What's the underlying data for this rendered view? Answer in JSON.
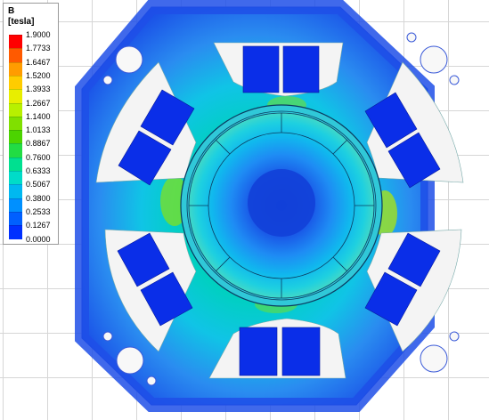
{
  "legend": {
    "quantity": "B",
    "unit": "[tesla]",
    "ticks": [
      "1.9000",
      "1.7733",
      "1.6467",
      "1.5200",
      "1.3933",
      "1.2667",
      "1.1400",
      "1.0133",
      "0.8867",
      "0.7600",
      "0.6333",
      "0.5067",
      "0.3800",
      "0.2533",
      "0.1267",
      "0.0000"
    ],
    "colors": [
      "#ff0000",
      "#ff5a00",
      "#ff9c00",
      "#ffcc00",
      "#e8ee00",
      "#b8f000",
      "#80e000",
      "#4cd400",
      "#22dc44",
      "#00e090",
      "#00dcc8",
      "#00b8f0",
      "#0090ff",
      "#0060ff",
      "#0030ff",
      "#0000f0"
    ]
  },
  "field_colors": {
    "yoke": "#2f6cf2",
    "yoke_light": "#1fc8e8",
    "tooth": "#00d8a8",
    "tooth_high": "#70e030",
    "air_ring": "#30c8d8",
    "rotor_outer": "#10c0e8",
    "rotor_mid": "#1e8cf4",
    "rotor_core": "#1846e0",
    "coil": "#0a2ee8",
    "slot_white": "#f4f4f4"
  }
}
